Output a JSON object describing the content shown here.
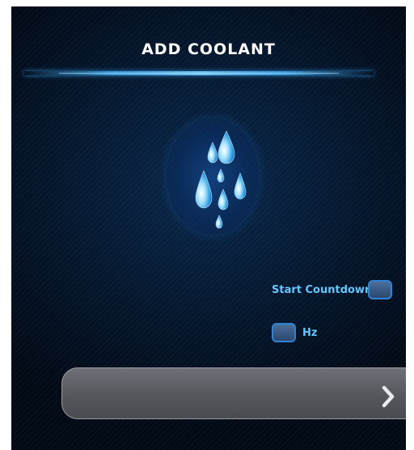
{
  "screen": {
    "title": "ADD COOLANT"
  },
  "icon": {
    "name": "coolant-drops-icon"
  },
  "controls": {
    "start_countdown_label": "Start Countdown",
    "hz_label": "Hz",
    "next_icon": "chevron-right-icon"
  },
  "colors": {
    "background": "#04152b",
    "accent": "#62c7ff",
    "title_line": "#3a9bd8",
    "bar": "#5d5f65"
  }
}
